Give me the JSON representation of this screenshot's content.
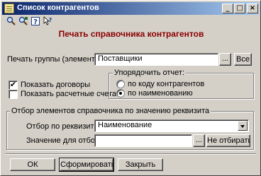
{
  "window": {
    "title": "Список контрагентов",
    "controls": {
      "minimize": "_",
      "maximize": "□",
      "close": "×"
    }
  },
  "toolbar": {
    "icons": [
      "search-icon",
      "search-next-icon",
      "help-icon",
      "what-is-icon"
    ]
  },
  "heading": "Печать справочника контрагентов",
  "group_row": {
    "label": "Печать группы (элемента):",
    "value": "Поставщики",
    "select_button": "...",
    "all_button": "Все"
  },
  "options": {
    "show_contracts": {
      "label": "Показать договоры",
      "checked": true
    },
    "show_accounts": {
      "label": "Показать расчетные счета",
      "checked": false
    }
  },
  "sort_group": {
    "title": "Упорядочить отчет:",
    "options": [
      {
        "label": "по коду контрагентов",
        "selected": false
      },
      {
        "label": "по наименованию",
        "selected": true
      }
    ]
  },
  "filter_group": {
    "title": "Отбор элементов справочника по значению реквизита",
    "attribute_label": "Отбор по реквизиту:",
    "attribute_value": "Наименование",
    "value_label": "Значение для отбора:",
    "value_value": "",
    "value_select_button": "...",
    "clear_button": "Не отбирать"
  },
  "footer": {
    "ok": "ОК",
    "build": "Сформировать",
    "close": "Закрыть"
  },
  "colors": {
    "titlebar_start": "#0a246a",
    "titlebar_end": "#a6caf0",
    "heading": "#8b0000",
    "face": "#d4d0c8"
  }
}
